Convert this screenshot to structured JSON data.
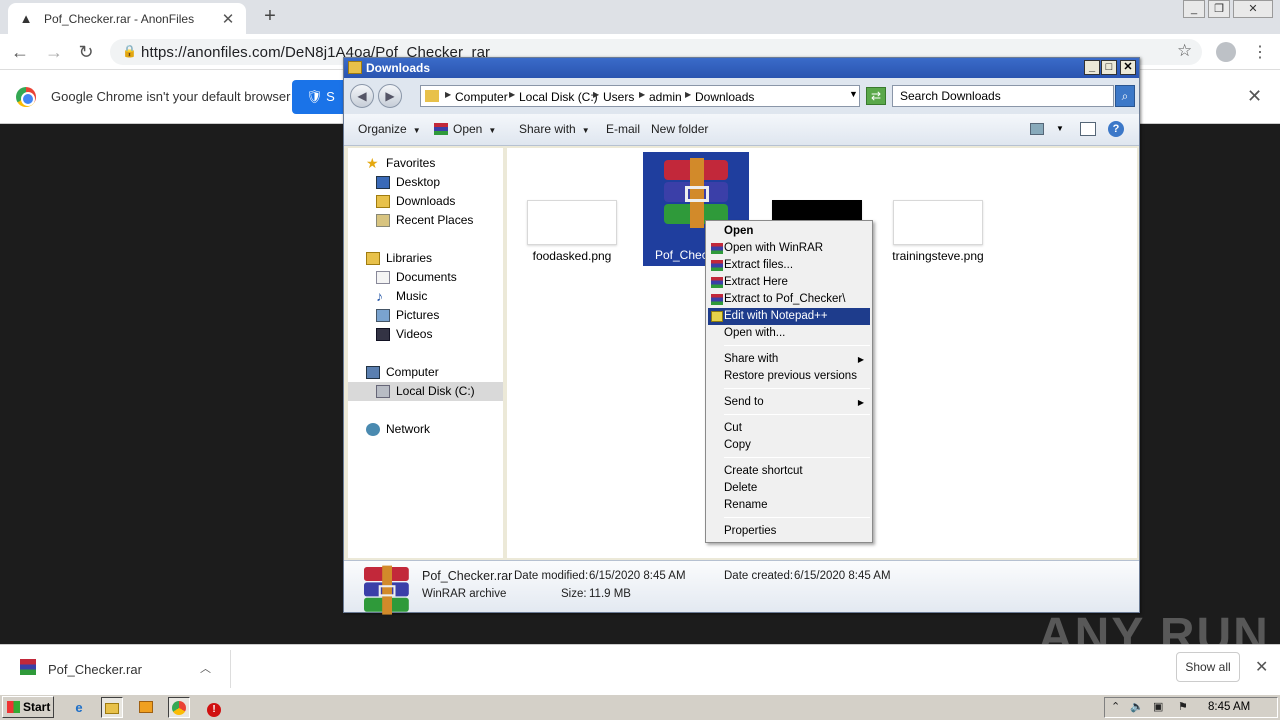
{
  "browser": {
    "tab_title": "Pof_Checker.rar - AnonFiles",
    "url": "https://anonfiles.com/DeN8j1A4oa/Pof_Checker_rar",
    "infobar_text": "Google Chrome isn't your default browser",
    "infobar_button": "S"
  },
  "explorer": {
    "title": "Downloads",
    "breadcrumb": [
      "Computer",
      "Local Disk (C:)",
      "Users",
      "admin",
      "Downloads"
    ],
    "search_placeholder": "Search Downloads",
    "toolbar": {
      "organize": "Organize",
      "open": "Open",
      "share_with": "Share with",
      "email": "E-mail",
      "new_folder": "New folder"
    },
    "nav": {
      "favorites": "Favorites",
      "desktop": "Desktop",
      "downloads": "Downloads",
      "recent": "Recent Places",
      "libraries": "Libraries",
      "documents": "Documents",
      "music": "Music",
      "pictures": "Pictures",
      "videos": "Videos",
      "computer": "Computer",
      "local_disk": "Local Disk (C:)",
      "network": "Network"
    },
    "files": {
      "f1": "foodasked.png",
      "f2": "Pof_Check",
      "f4": "trainingsteve.png"
    },
    "details": {
      "name": "Pof_Checker.rar",
      "type": "WinRAR archive",
      "modified_label": "Date modified:",
      "modified": "6/15/2020 8:45 AM",
      "created_label": "Date created:",
      "created": "6/15/2020 8:45 AM",
      "size_label": "Size:",
      "size": "11.9 MB"
    }
  },
  "context_menu": {
    "open": "Open",
    "open_winrar": "Open with WinRAR",
    "extract_files": "Extract files...",
    "extract_here": "Extract Here",
    "extract_to": "Extract to Pof_Checker\\",
    "edit_npp": "Edit with Notepad++",
    "open_with": "Open with...",
    "share_with": "Share with",
    "restore": "Restore previous versions",
    "send_to": "Send to",
    "cut": "Cut",
    "copy": "Copy",
    "create_shortcut": "Create shortcut",
    "delete": "Delete",
    "rename": "Rename",
    "properties": "Properties"
  },
  "downloads_shelf": {
    "file": "Pof_Checker.rar",
    "show_all": "Show all"
  },
  "taskbar": {
    "start": "Start",
    "clock": "8:45 AM"
  },
  "watermark": "ANY RUN"
}
